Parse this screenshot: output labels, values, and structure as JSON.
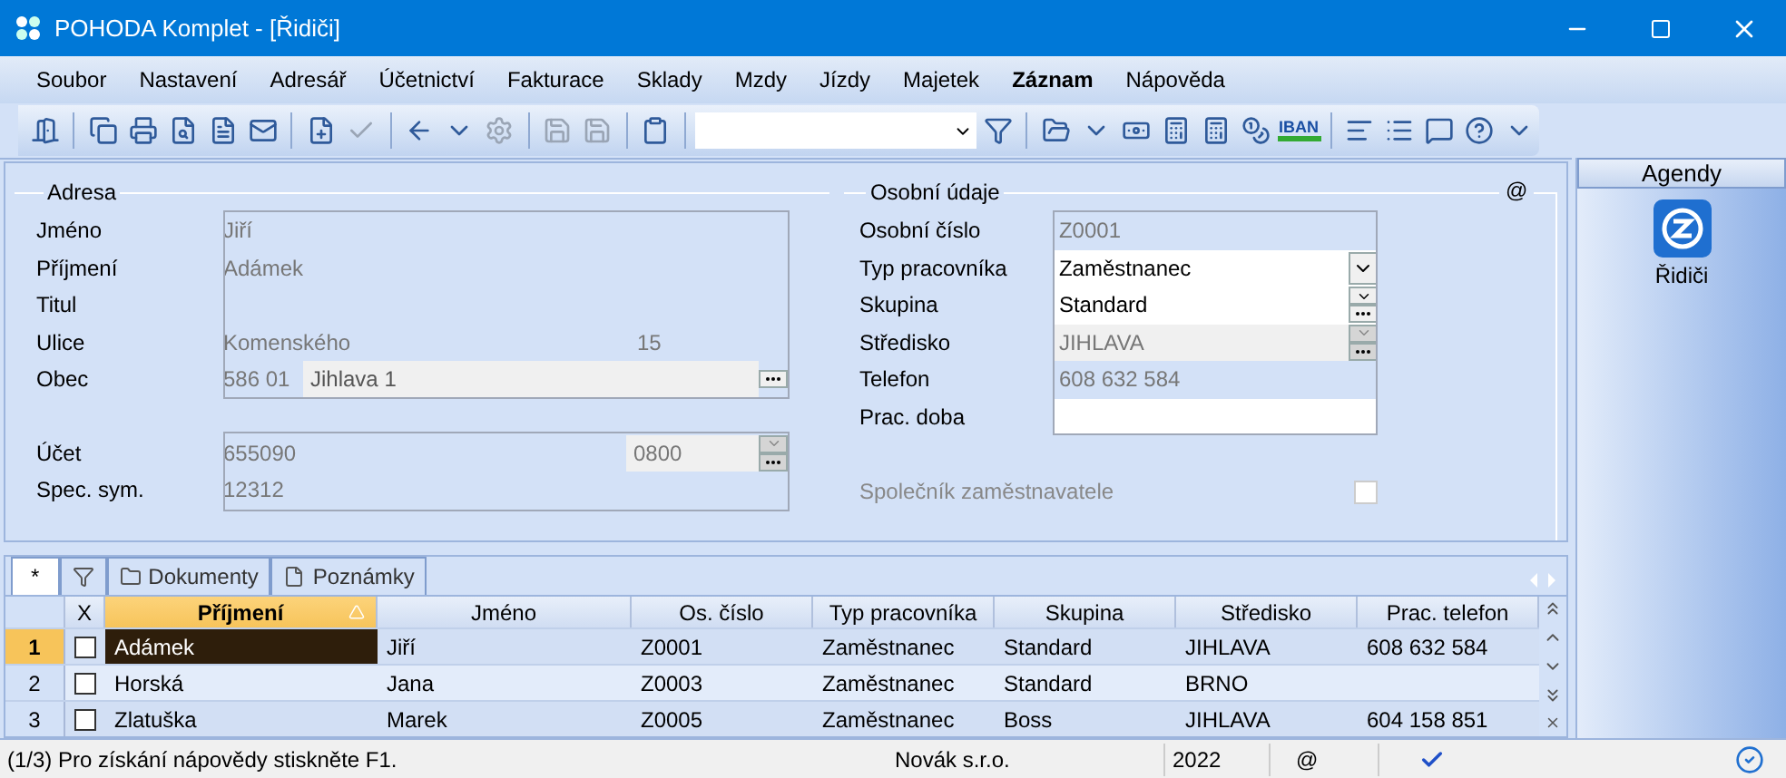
{
  "window": {
    "title": "POHODA Komplet - [Řidiči]"
  },
  "menu": [
    {
      "label": "Soubor",
      "bold": false
    },
    {
      "label": "Nastavení",
      "bold": false
    },
    {
      "label": "Adresář",
      "bold": false
    },
    {
      "label": "Účetnictví",
      "bold": false
    },
    {
      "label": "Fakturace",
      "bold": false
    },
    {
      "label": "Sklady",
      "bold": false
    },
    {
      "label": "Mzdy",
      "bold": false
    },
    {
      "label": "Jízdy",
      "bold": false
    },
    {
      "label": "Majetek",
      "bold": false
    },
    {
      "label": "Záznam",
      "bold": true
    },
    {
      "label": "Nápověda",
      "bold": false
    }
  ],
  "toolbar": {
    "iban": "IBAN"
  },
  "address": {
    "title": "Adresa",
    "fields": [
      {
        "kind": "text",
        "label": "Jméno",
        "value": "Jiří"
      },
      {
        "kind": "text",
        "label": "Příjmení",
        "value": "Adámek"
      },
      {
        "kind": "text",
        "label": "Titul"
      },
      {
        "kind": "street",
        "label": "Ulice",
        "value": "Komenského",
        "number": "15"
      },
      {
        "kind": "city",
        "label": "Obec",
        "zip": "586 01",
        "value": "Jihlava 1"
      }
    ],
    "bank": [
      {
        "kind": "account",
        "label": "Účet",
        "value": "655090",
        "code": "0800"
      },
      {
        "kind": "text",
        "label": "Spec. sym.",
        "value": "12312"
      }
    ]
  },
  "personal": {
    "title": "Osobní údaje",
    "at": "@",
    "fields": [
      {
        "kind": "readonly",
        "label": "Osobní číslo",
        "value": "Z0001"
      },
      {
        "kind": "combo",
        "label": "Typ pracovníka",
        "value": "Zaměstnanec",
        "disabled": false
      },
      {
        "kind": "combo-list",
        "label": "Skupina",
        "value": "Standard",
        "disabled": false
      },
      {
        "kind": "combo-list",
        "label": "Středisko",
        "value": "JIHLAVA",
        "disabled": true
      },
      {
        "kind": "readonly",
        "label": "Telefon",
        "value": "608 632 584"
      },
      {
        "kind": "edit",
        "label": "Prac. doba"
      }
    ],
    "partner": {
      "label": "Společník zaměstnavatele",
      "checked": false,
      "disabled": true
    }
  },
  "agendy": {
    "title": "Agendy",
    "items": [
      {
        "label": "Řidiči"
      }
    ]
  },
  "tabs": [
    {
      "kind": "star",
      "label": "*",
      "selected": true
    },
    {
      "kind": "filter",
      "selected": false
    },
    {
      "kind": "folder",
      "label": "Dokumenty",
      "selected": false
    },
    {
      "kind": "note",
      "label": "Poznámky",
      "selected": false
    }
  ],
  "table": {
    "checkbox_column": "X",
    "columns": [
      {
        "label": "Příjmení",
        "sorted": true
      },
      {
        "label": "Jméno",
        "sorted": false
      },
      {
        "label": "Os. číslo",
        "sorted": false
      },
      {
        "label": "Typ pracovníka",
        "sorted": false
      },
      {
        "label": "Skupina",
        "sorted": false
      },
      {
        "label": "Středisko",
        "sorted": false
      },
      {
        "label": "Prac. telefon",
        "sorted": false
      }
    ],
    "rows": [
      {
        "number": "1",
        "selected": true,
        "checked": false,
        "cells": [
          "Adámek",
          "Jiří",
          "Z0001",
          "Zaměstnanec",
          "Standard",
          "JIHLAVA",
          "608 632 584"
        ]
      },
      {
        "number": "2",
        "selected": false,
        "checked": false,
        "cells": [
          "Horská",
          "Jana",
          "Z0003",
          "Zaměstnanec",
          "Standard",
          "BRNO",
          ""
        ]
      },
      {
        "number": "3",
        "selected": false,
        "checked": false,
        "cells": [
          "Zlatuška",
          "Marek",
          "Z0005",
          "Zaměstnanec",
          "Boss",
          "JIHLAVA",
          "604 158 851"
        ]
      }
    ]
  },
  "status_bar": {
    "message": "(1/3) Pro získání nápovědy stiskněte F1.",
    "company": "Novák s.r.o.",
    "year": "2022",
    "at": "@"
  }
}
